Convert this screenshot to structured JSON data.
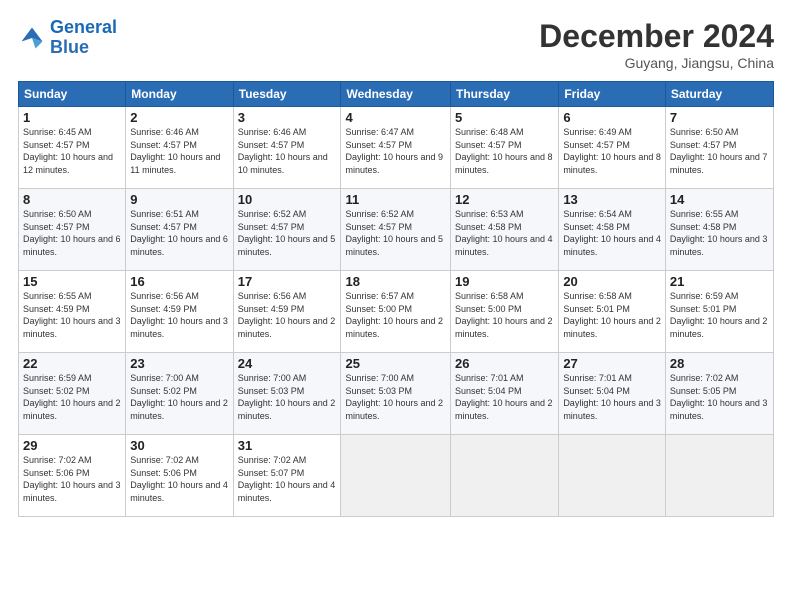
{
  "header": {
    "logo_line1": "General",
    "logo_line2": "Blue",
    "month": "December 2024",
    "location": "Guyang, Jiangsu, China"
  },
  "weekdays": [
    "Sunday",
    "Monday",
    "Tuesday",
    "Wednesday",
    "Thursday",
    "Friday",
    "Saturday"
  ],
  "weeks": [
    [
      {
        "day": "1",
        "sunrise": "6:45 AM",
        "sunset": "4:57 PM",
        "daylight": "10 hours and 12 minutes."
      },
      {
        "day": "2",
        "sunrise": "6:46 AM",
        "sunset": "4:57 PM",
        "daylight": "10 hours and 11 minutes."
      },
      {
        "day": "3",
        "sunrise": "6:46 AM",
        "sunset": "4:57 PM",
        "daylight": "10 hours and 10 minutes."
      },
      {
        "day": "4",
        "sunrise": "6:47 AM",
        "sunset": "4:57 PM",
        "daylight": "10 hours and 9 minutes."
      },
      {
        "day": "5",
        "sunrise": "6:48 AM",
        "sunset": "4:57 PM",
        "daylight": "10 hours and 8 minutes."
      },
      {
        "day": "6",
        "sunrise": "6:49 AM",
        "sunset": "4:57 PM",
        "daylight": "10 hours and 8 minutes."
      },
      {
        "day": "7",
        "sunrise": "6:50 AM",
        "sunset": "4:57 PM",
        "daylight": "10 hours and 7 minutes."
      }
    ],
    [
      {
        "day": "8",
        "sunrise": "6:50 AM",
        "sunset": "4:57 PM",
        "daylight": "10 hours and 6 minutes."
      },
      {
        "day": "9",
        "sunrise": "6:51 AM",
        "sunset": "4:57 PM",
        "daylight": "10 hours and 6 minutes."
      },
      {
        "day": "10",
        "sunrise": "6:52 AM",
        "sunset": "4:57 PM",
        "daylight": "10 hours and 5 minutes."
      },
      {
        "day": "11",
        "sunrise": "6:52 AM",
        "sunset": "4:57 PM",
        "daylight": "10 hours and 5 minutes."
      },
      {
        "day": "12",
        "sunrise": "6:53 AM",
        "sunset": "4:58 PM",
        "daylight": "10 hours and 4 minutes."
      },
      {
        "day": "13",
        "sunrise": "6:54 AM",
        "sunset": "4:58 PM",
        "daylight": "10 hours and 4 minutes."
      },
      {
        "day": "14",
        "sunrise": "6:55 AM",
        "sunset": "4:58 PM",
        "daylight": "10 hours and 3 minutes."
      }
    ],
    [
      {
        "day": "15",
        "sunrise": "6:55 AM",
        "sunset": "4:59 PM",
        "daylight": "10 hours and 3 minutes."
      },
      {
        "day": "16",
        "sunrise": "6:56 AM",
        "sunset": "4:59 PM",
        "daylight": "10 hours and 3 minutes."
      },
      {
        "day": "17",
        "sunrise": "6:56 AM",
        "sunset": "4:59 PM",
        "daylight": "10 hours and 2 minutes."
      },
      {
        "day": "18",
        "sunrise": "6:57 AM",
        "sunset": "5:00 PM",
        "daylight": "10 hours and 2 minutes."
      },
      {
        "day": "19",
        "sunrise": "6:58 AM",
        "sunset": "5:00 PM",
        "daylight": "10 hours and 2 minutes."
      },
      {
        "day": "20",
        "sunrise": "6:58 AM",
        "sunset": "5:01 PM",
        "daylight": "10 hours and 2 minutes."
      },
      {
        "day": "21",
        "sunrise": "6:59 AM",
        "sunset": "5:01 PM",
        "daylight": "10 hours and 2 minutes."
      }
    ],
    [
      {
        "day": "22",
        "sunrise": "6:59 AM",
        "sunset": "5:02 PM",
        "daylight": "10 hours and 2 minutes."
      },
      {
        "day": "23",
        "sunrise": "7:00 AM",
        "sunset": "5:02 PM",
        "daylight": "10 hours and 2 minutes."
      },
      {
        "day": "24",
        "sunrise": "7:00 AM",
        "sunset": "5:03 PM",
        "daylight": "10 hours and 2 minutes."
      },
      {
        "day": "25",
        "sunrise": "7:00 AM",
        "sunset": "5:03 PM",
        "daylight": "10 hours and 2 minutes."
      },
      {
        "day": "26",
        "sunrise": "7:01 AM",
        "sunset": "5:04 PM",
        "daylight": "10 hours and 2 minutes."
      },
      {
        "day": "27",
        "sunrise": "7:01 AM",
        "sunset": "5:04 PM",
        "daylight": "10 hours and 3 minutes."
      },
      {
        "day": "28",
        "sunrise": "7:02 AM",
        "sunset": "5:05 PM",
        "daylight": "10 hours and 3 minutes."
      }
    ],
    [
      {
        "day": "29",
        "sunrise": "7:02 AM",
        "sunset": "5:06 PM",
        "daylight": "10 hours and 3 minutes."
      },
      {
        "day": "30",
        "sunrise": "7:02 AM",
        "sunset": "5:06 PM",
        "daylight": "10 hours and 4 minutes."
      },
      {
        "day": "31",
        "sunrise": "7:02 AM",
        "sunset": "5:07 PM",
        "daylight": "10 hours and 4 minutes."
      },
      null,
      null,
      null,
      null
    ]
  ]
}
